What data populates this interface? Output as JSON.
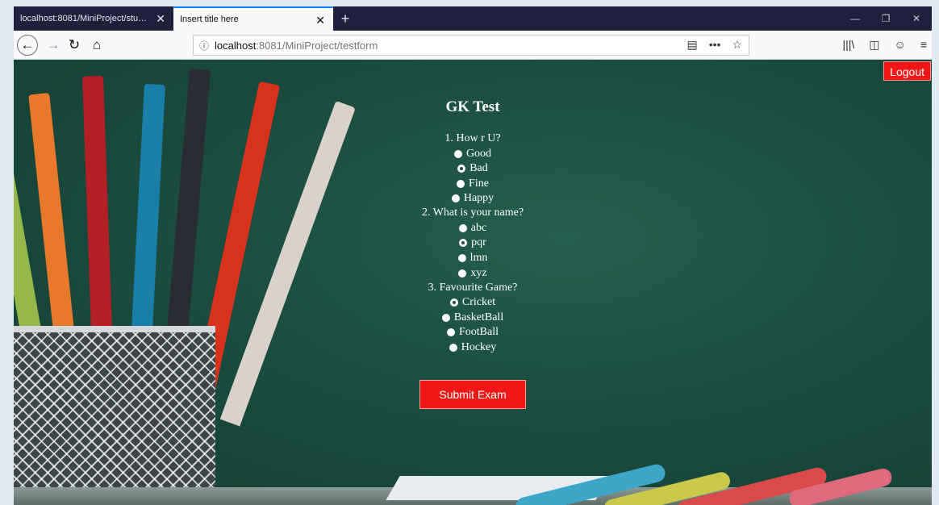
{
  "tabs": [
    {
      "title": "localhost:8081/MiniProject/student",
      "close": "✕",
      "active": false
    },
    {
      "title": "Insert title here",
      "close": "✕",
      "active": true
    }
  ],
  "newtab_label": "+",
  "window_controls": {
    "minimize": "—",
    "restore": "❐",
    "close": "✕"
  },
  "toolbar": {
    "back": "←",
    "forward": "→",
    "reload": "↻",
    "home": "⌂",
    "url_host": "localhost",
    "url_rest": ":8081/MiniProject/testform",
    "url_icons": {
      "reader": "▤",
      "more": "•••",
      "bookmark": "☆"
    },
    "right_icons": {
      "library": "|||\\",
      "sidebar": "◫",
      "account": "☺",
      "menu": "≡"
    }
  },
  "page": {
    "logout_label": "Logout",
    "title": "GK Test",
    "questions": [
      {
        "text": "1.  How r U?",
        "options": [
          {
            "label": "Good",
            "checked": false
          },
          {
            "label": "Bad",
            "checked": true
          },
          {
            "label": "Fine",
            "checked": false
          },
          {
            "label": "Happy",
            "checked": false
          }
        ]
      },
      {
        "text": "2.  What is your name?",
        "options": [
          {
            "label": "abc",
            "checked": false
          },
          {
            "label": "pqr",
            "checked": true
          },
          {
            "label": "lmn",
            "checked": false
          },
          {
            "label": "xyz",
            "checked": false
          }
        ]
      },
      {
        "text": "3.  Favourite Game?",
        "options": [
          {
            "label": "Cricket",
            "checked": true
          },
          {
            "label": "BasketBall",
            "checked": false
          },
          {
            "label": "FootBall",
            "checked": false
          },
          {
            "label": "Hockey",
            "checked": false
          }
        ]
      }
    ],
    "submit_label": "Submit Exam"
  },
  "colors": {
    "accent_red": "#f21616",
    "board_green": "#1b4d40",
    "tab_strip": "#1f1f3e"
  }
}
